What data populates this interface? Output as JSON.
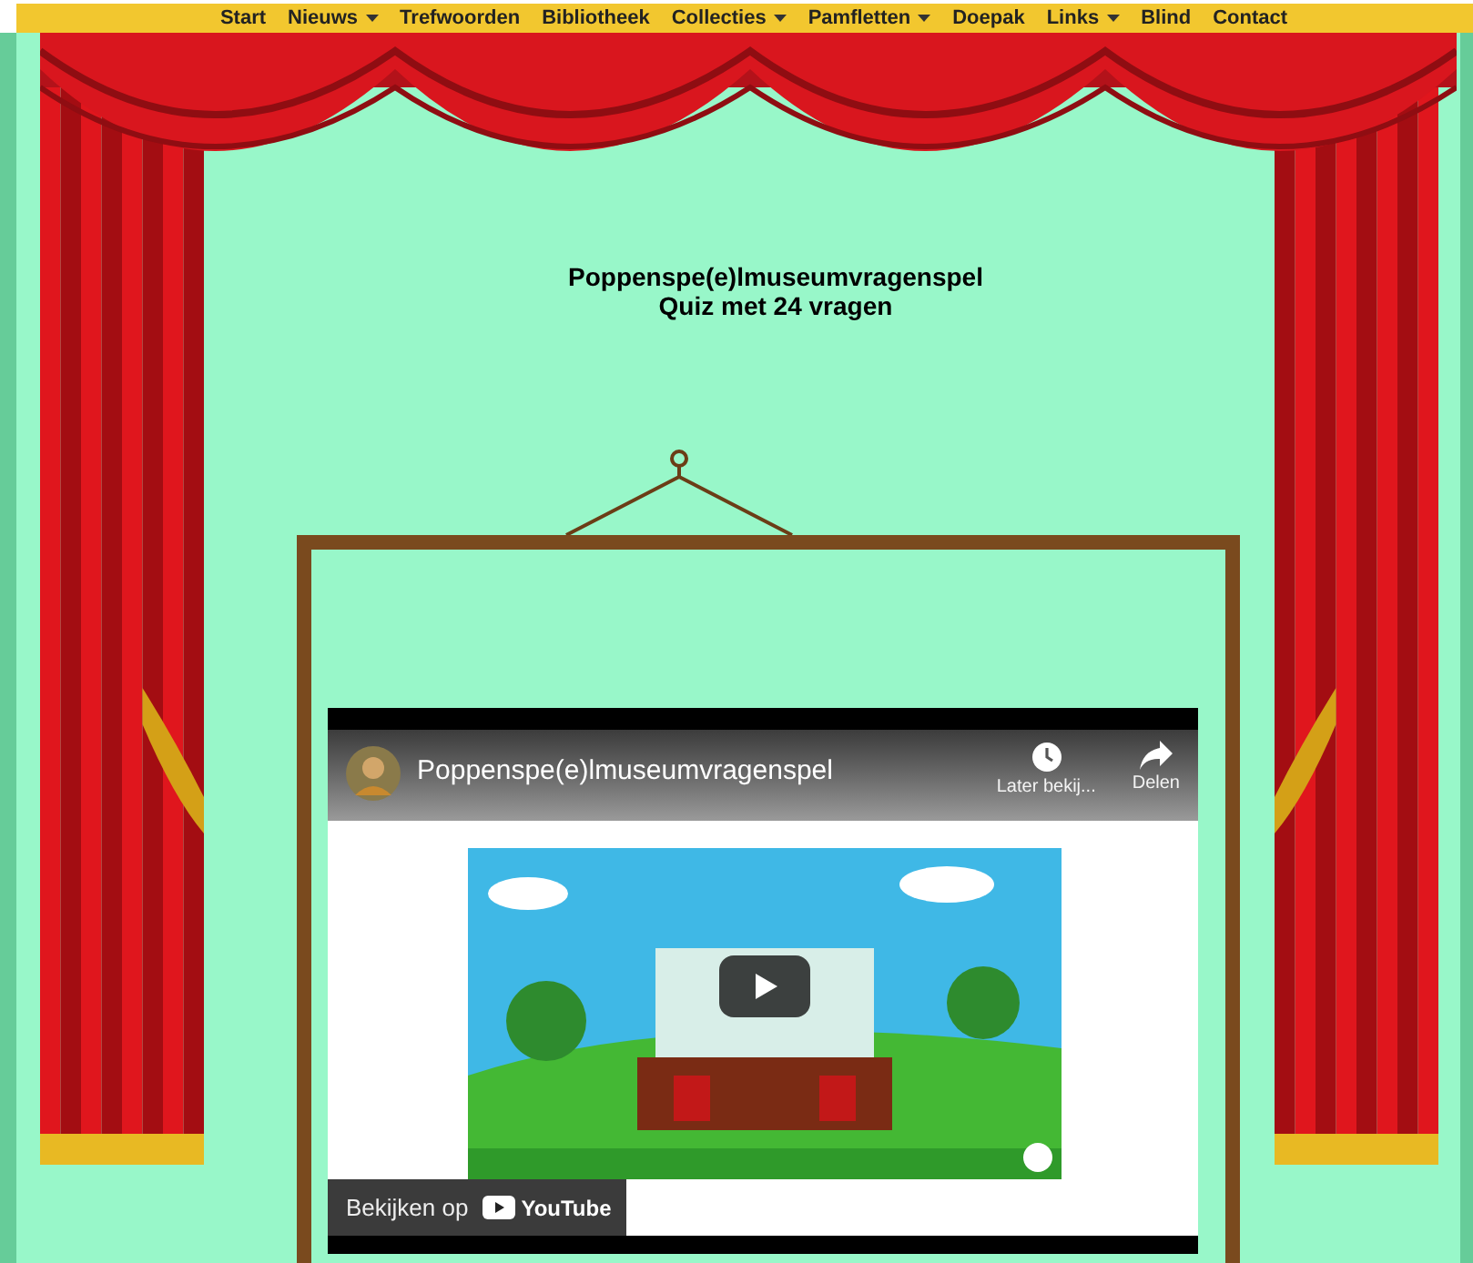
{
  "nav": [
    {
      "label": "Start",
      "dropdown": false
    },
    {
      "label": "Nieuws",
      "dropdown": true
    },
    {
      "label": "Trefwoorden",
      "dropdown": false
    },
    {
      "label": "Bibliotheek",
      "dropdown": false
    },
    {
      "label": "Collecties",
      "dropdown": true
    },
    {
      "label": "Pamfletten",
      "dropdown": true
    },
    {
      "label": "Doepak",
      "dropdown": false
    },
    {
      "label": "Links",
      "dropdown": true
    },
    {
      "label": "Blind",
      "dropdown": false
    },
    {
      "label": "Contact",
      "dropdown": false
    }
  ],
  "heading": [
    "Poppenspe(e)lmuseumvragenspel",
    "Quiz met 24 vragen"
  ],
  "video": {
    "title": "Poppenspe(e)lmuseumvragenspel",
    "actions": [
      {
        "kind": "watch_later",
        "label": "Later bekij..."
      },
      {
        "kind": "share",
        "label": "Delen"
      }
    ],
    "watch_on": "Bekijken op",
    "brand": "YouTube"
  }
}
